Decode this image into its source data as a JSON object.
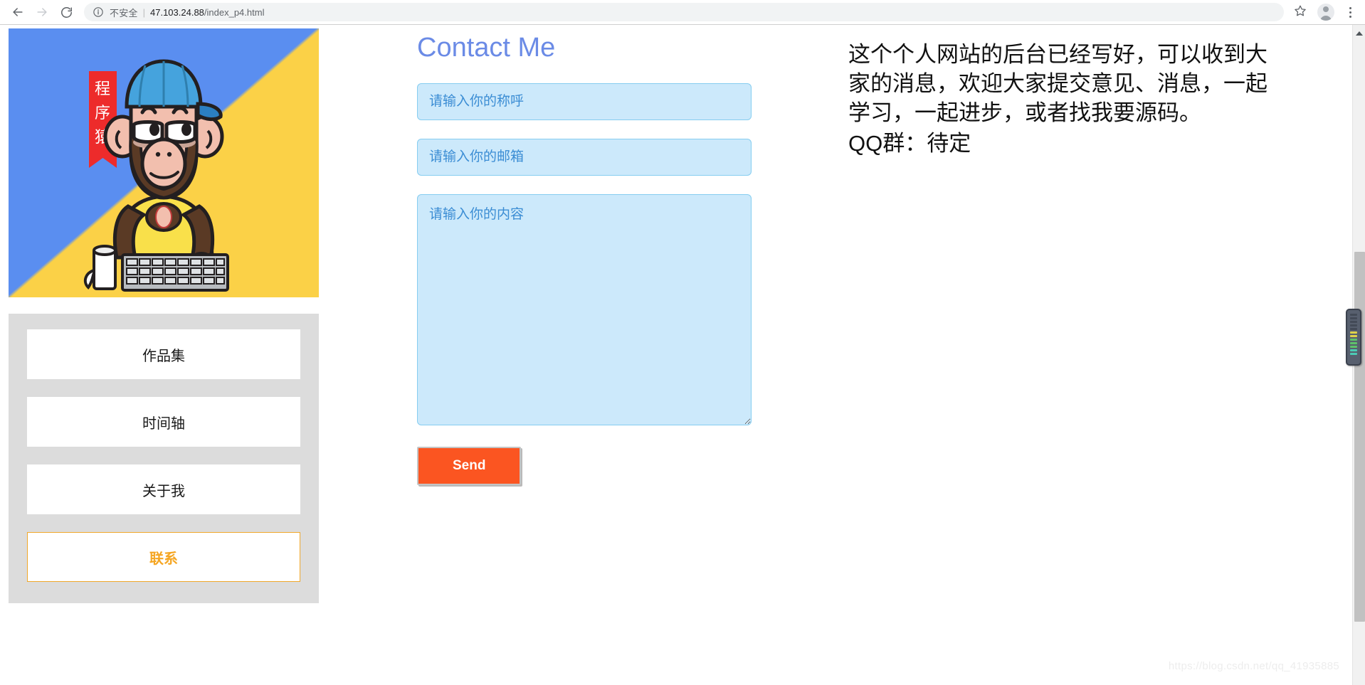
{
  "browser": {
    "back_icon": "back-arrow-icon",
    "forward_icon": "forward-arrow-icon",
    "reload_icon": "reload-icon",
    "security_icon": "info-circle-icon",
    "security_label": "不安全",
    "divider": "|",
    "url_host": "47.103.24.88",
    "url_path": "/index_p4.html",
    "bookmark_icon": "star-icon",
    "profile_icon": "profile-avatar-icon",
    "menu_icon": "three-dot-menu-icon"
  },
  "sidebar": {
    "avatar_alt": "programmer-monkey-avatar",
    "avatar_banner_text": "程序猿",
    "nav_items": [
      {
        "label": "作品集",
        "active": false
      },
      {
        "label": "时间轴",
        "active": false
      },
      {
        "label": "关于我",
        "active": false
      },
      {
        "label": "联系",
        "active": true
      }
    ]
  },
  "form": {
    "title": "Contact Me",
    "name_placeholder": "请输入你的称呼",
    "name_value": "",
    "email_placeholder": "请输入你的邮箱",
    "email_value": "",
    "message_placeholder": "请输入你的内容",
    "message_value": "",
    "send_label": "Send"
  },
  "note": {
    "body": "这个个人网站的后台已经写好，可以收到大家的消息，欢迎大家提交意见、消息，一起学习，一起进步，或者找我要源码。",
    "qq": "QQ群：待定"
  },
  "watermark": {
    "text": "https://blog.csdn.net/qq_41935885"
  },
  "scrollbar": {
    "up_arrow_icon": "scroll-up-arrow-icon"
  },
  "colors": {
    "accent_orange": "#f5a623",
    "send_orange": "#fb5521",
    "title_blue": "#6b8be6",
    "field_bg": "#cce9fb",
    "field_border": "#86cdf0",
    "field_text": "#3b8dd4",
    "nav_panel_bg": "#dcdcdc",
    "avatar_blue": "#5a8ef0",
    "avatar_yellow": "#fbd147"
  }
}
